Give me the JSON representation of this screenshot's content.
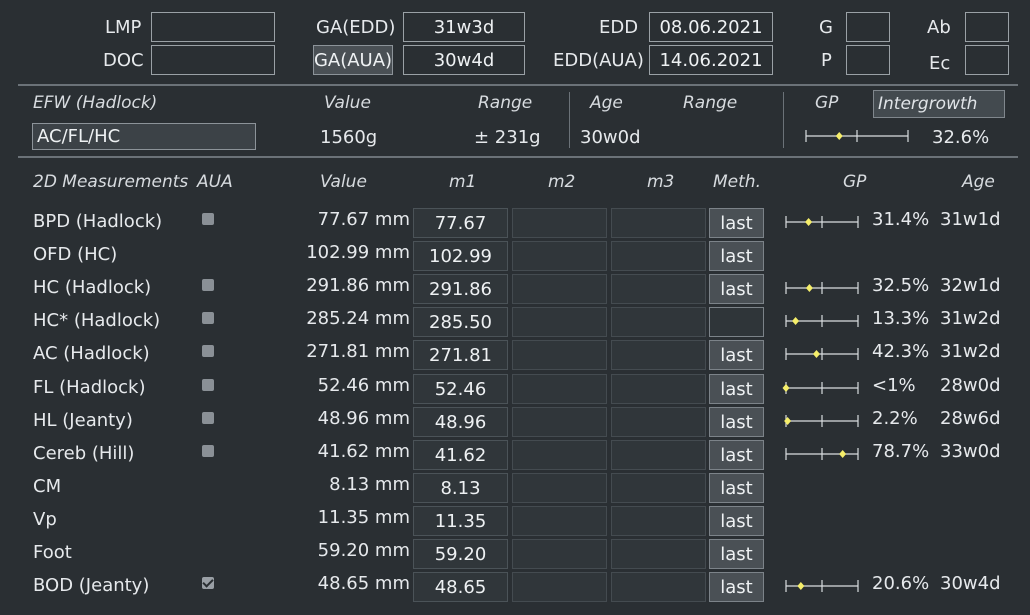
{
  "header": {
    "lmp_label": "LMP",
    "doc_label": "DOC",
    "lmp_value": "",
    "doc_value": "",
    "ga_edd_label": "GA(EDD)",
    "ga_edd_value": "31w3d",
    "ga_aua_label": "GA(AUA)",
    "ga_aua_value": "30w4d",
    "edd_label": "EDD",
    "edd_value": "08.06.2021",
    "edd_aua_label": "EDD(AUA)",
    "edd_aua_value": "14.06.2021",
    "g_label": "G",
    "p_label": "P",
    "ab_label": "Ab",
    "ec_label": "Ec",
    "g_value": "",
    "p_value": "",
    "ab_value": "",
    "ec_value": ""
  },
  "efw": {
    "title": "EFW (Hadlock)",
    "value_header": "Value",
    "range_header": "Range",
    "age_header": "Age",
    "age_range_header": "Range",
    "gp_header": "GP",
    "reference": "Intergrowth",
    "formula": "AC/FL/HC",
    "value": "1560g",
    "range": "± 231g",
    "age": "30w0d",
    "age_range": "",
    "gp_percent": "32.6%",
    "gp_fraction": 0.326
  },
  "table": {
    "headers": {
      "measurements": "2D Measurements",
      "aua": "AUA",
      "value": "Value",
      "m1": "m1",
      "m2": "m2",
      "m3": "m3",
      "method": "Meth.",
      "gp": "GP",
      "age": "Age"
    },
    "rows": [
      {
        "name": "BPD (Hadlock)",
        "aua": "unchecked",
        "value": "77.67 mm",
        "m1": "77.67",
        "m2": "",
        "m3": "",
        "method": "last",
        "gp": "31.4%",
        "age": "31w1d",
        "gp_fraction": 0.314
      },
      {
        "name": "OFD (HC)",
        "aua": "none",
        "value": "102.99 mm",
        "m1": "102.99",
        "m2": "",
        "m3": "",
        "method": "last",
        "gp": "",
        "age": "",
        "gp_fraction": null
      },
      {
        "name": "HC (Hadlock)",
        "aua": "unchecked",
        "value": "291.86 mm",
        "m1": "291.86",
        "m2": "",
        "m3": "",
        "method": "last",
        "gp": "32.5%",
        "age": "32w1d",
        "gp_fraction": 0.325
      },
      {
        "name": "HC* (Hadlock)",
        "aua": "unchecked",
        "value": "285.24 mm",
        "m1": "285.50",
        "m2": "",
        "m3": "",
        "method": "",
        "gp": "13.3%",
        "age": "31w2d",
        "gp_fraction": 0.133
      },
      {
        "name": "AC (Hadlock)",
        "aua": "unchecked",
        "value": "271.81 mm",
        "m1": "271.81",
        "m2": "",
        "m3": "",
        "method": "last",
        "gp": "42.3%",
        "age": "31w2d",
        "gp_fraction": 0.423
      },
      {
        "name": "FL (Hadlock)",
        "aua": "unchecked",
        "value": "52.46 mm",
        "m1": "52.46",
        "m2": "",
        "m3": "",
        "method": "last",
        "gp": "<1%",
        "age": "28w0d",
        "gp_fraction": 0.0
      },
      {
        "name": "HL (Jeanty)",
        "aua": "unchecked",
        "value": "48.96 mm",
        "m1": "48.96",
        "m2": "",
        "m3": "",
        "method": "last",
        "gp": "2.2%",
        "age": "28w6d",
        "gp_fraction": 0.022
      },
      {
        "name": "Cereb (Hill)",
        "aua": "unchecked",
        "value": "41.62 mm",
        "m1": "41.62",
        "m2": "",
        "m3": "",
        "method": "last",
        "gp": "78.7%",
        "age": "33w0d",
        "gp_fraction": 0.787
      },
      {
        "name": "CM",
        "aua": "none",
        "value": "8.13 mm",
        "m1": "8.13",
        "m2": "",
        "m3": "",
        "method": "last",
        "gp": "",
        "age": "",
        "gp_fraction": null
      },
      {
        "name": "Vp",
        "aua": "none",
        "value": "11.35 mm",
        "m1": "11.35",
        "m2": "",
        "m3": "",
        "method": "last",
        "gp": "",
        "age": "",
        "gp_fraction": null
      },
      {
        "name": "Foot",
        "aua": "none",
        "value": "59.20 mm",
        "m1": "59.20",
        "m2": "",
        "m3": "",
        "method": "last",
        "gp": "",
        "age": "",
        "gp_fraction": null
      },
      {
        "name": "BOD (Jeanty)",
        "aua": "checked",
        "value": "48.65 mm",
        "m1": "48.65",
        "m2": "",
        "m3": "",
        "method": "last",
        "gp": "20.6%",
        "age": "30w4d",
        "gp_fraction": 0.206
      }
    ]
  },
  "colors": {
    "background": "#2a2f33",
    "marker": "#f5ee6a",
    "gauge_line": "#d9dde0"
  }
}
